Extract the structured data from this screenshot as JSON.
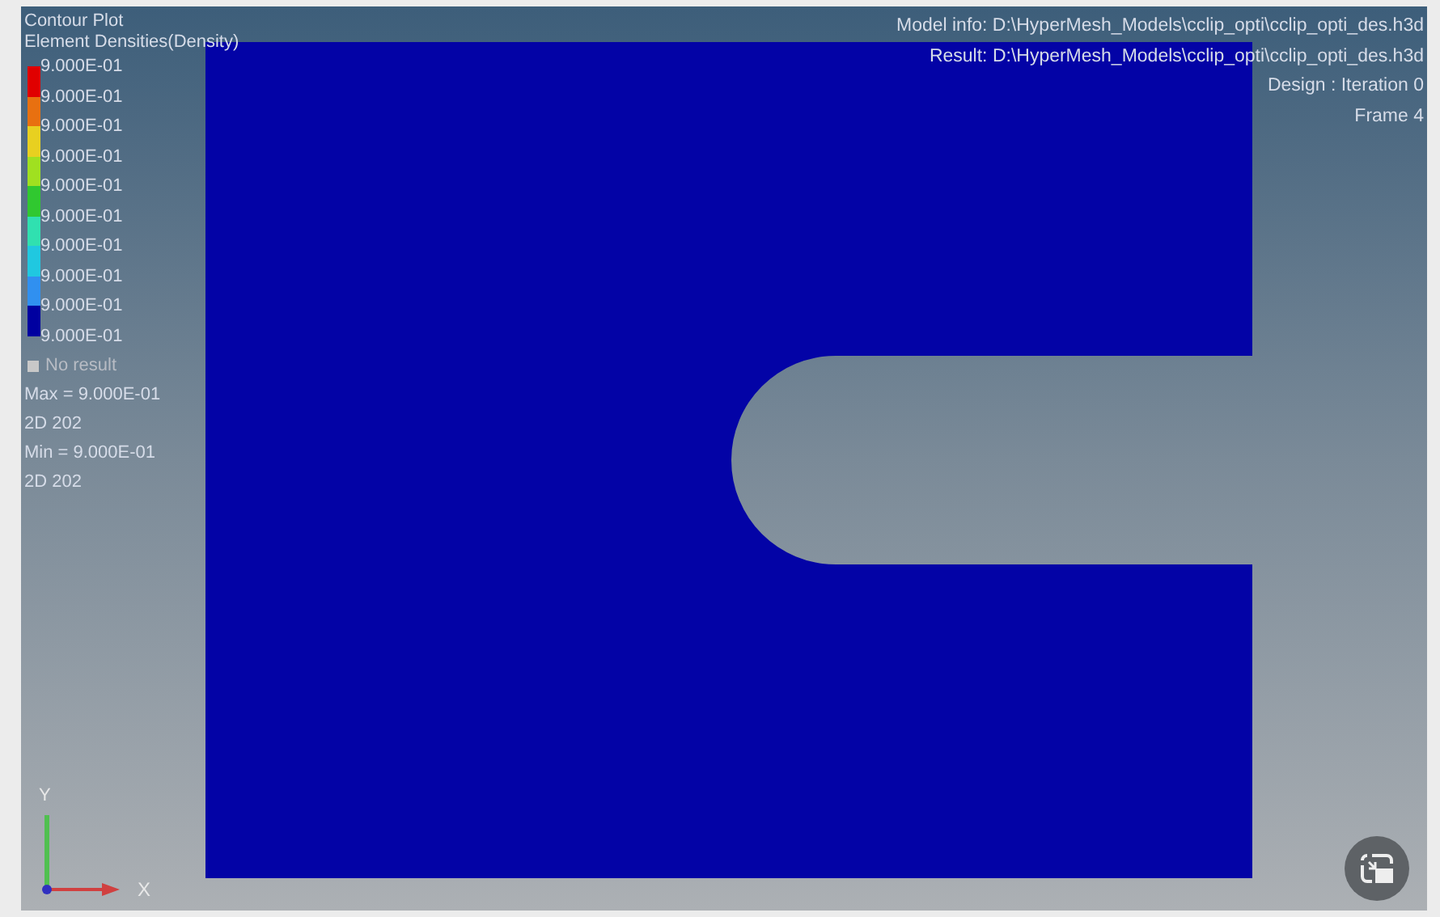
{
  "plot": {
    "title": "Contour Plot",
    "subtitle": "Element Densities(Density)"
  },
  "legend": {
    "values": [
      "9.000E-01",
      "9.000E-01",
      "9.000E-01",
      "9.000E-01",
      "9.000E-01",
      "9.000E-01",
      "9.000E-01",
      "9.000E-01",
      "9.000E-01",
      "9.000E-01"
    ],
    "bands": [
      {
        "color": "#e00000"
      },
      {
        "color": "#e87010"
      },
      {
        "color": "#e8d020"
      },
      {
        "color": "#a0e020"
      },
      {
        "color": "#30c830"
      },
      {
        "color": "#30e0b0"
      },
      {
        "color": "#20c8e0"
      },
      {
        "color": "#3090f0"
      },
      {
        "color": "#0000a0"
      }
    ],
    "no_result": "No result"
  },
  "stats": [
    "Max = 9.000E-01",
    "2D 202",
    "Min = 9.000E-01",
    "2D 202"
  ],
  "info": [
    "Model info: D:\\HyperMesh_Models\\cclip_opti\\cclip_opti_des.h3d",
    "Result: D:\\HyperMesh_Models\\cclip_opti\\cclip_opti_des.h3d",
    "Design : Iteration 0",
    "Frame 4"
  ],
  "axes": {
    "x": "X",
    "y": "Y"
  }
}
